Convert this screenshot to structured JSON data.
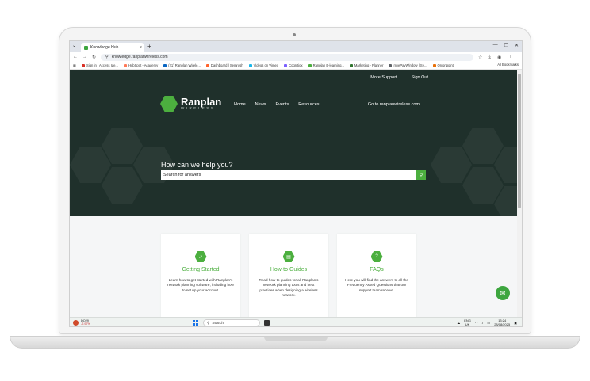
{
  "browser": {
    "tab_title": "Knowledge Hub",
    "tab_close": "×",
    "new_tab": "+",
    "url": "knowledge.ranplanwireless.com",
    "bookmarks": [
      {
        "label": "Sign in | Access Ide...",
        "color": "#d93025"
      },
      {
        "label": "HubSpot - Academy",
        "color": "#ff7a59"
      },
      {
        "label": "(21) Ranplan Wirele...",
        "color": "#0a66c2"
      },
      {
        "label": "Dashboard | Semrush",
        "color": "#ff642d"
      },
      {
        "label": "Videos on Vimeo",
        "color": "#1ab7ea"
      },
      {
        "label": "Cognitiox",
        "color": "#7b61ff"
      },
      {
        "label": "Ranplan E-learning...",
        "color": "#4caf3f"
      },
      {
        "label": "Marketing - Planner",
        "color": "#31752f"
      },
      {
        "label": "myePayWindow | Se...",
        "color": "#5f6368"
      },
      {
        "label": "Onionpoint",
        "color": "#e8710a"
      }
    ],
    "all_bookmarks": "All Bookmarks"
  },
  "site": {
    "top_links": [
      "More Support",
      "Sign Out"
    ],
    "logo_name": "Ranplan",
    "logo_sub": "WIRELESS",
    "nav": [
      "Home",
      "News",
      "Events",
      "Resources"
    ],
    "goto": "Go to ranplanwireless.com",
    "hero_heading": "How can we help you?",
    "search_placeholder": "Search for answers"
  },
  "cards": [
    {
      "title": "Getting Started",
      "desc": "Learn how to get started with Ranplan's network planning software, including how to set up your account."
    },
    {
      "title": "How-to Guides",
      "desc": "Read how-to guides for all Ranplan's network planning tools and best practices when designing a wireless network."
    },
    {
      "title": "FAQs",
      "desc": "Here you will find the answers to all the Frequently Asked Questions that our support team receive."
    }
  ],
  "taskbar": {
    "ticker": "DQ29",
    "ticker_change": "-2.97%",
    "search": "Search",
    "lang_top": "ENG",
    "lang_bottom": "UK",
    "time": "13:24",
    "date": "28/08/2025"
  },
  "colors": {
    "brand_green": "#4caf3f",
    "hero_bg": "#1f302b"
  }
}
